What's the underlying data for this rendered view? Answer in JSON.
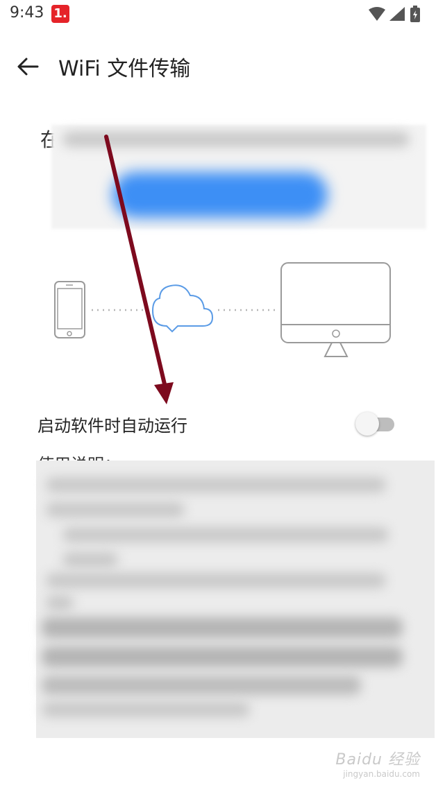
{
  "status_bar": {
    "time": "9:43",
    "badge": "1."
  },
  "appbar": {
    "title": "WiFi 文件传输"
  },
  "intro": {
    "partial_char": "在"
  },
  "settings": {
    "auto_run_label": "启动软件时自动运行",
    "auto_run_enabled": false
  },
  "usage": {
    "heading": "使用说明："
  },
  "watermark": {
    "brand": "Baidu 经验",
    "url": "jingyan.baidu.com"
  },
  "colors": {
    "accent_blue": "#3d8ff5",
    "cloud_blue": "#5a9be6",
    "arrow": "#7d0a1e",
    "badge_red": "#e52329"
  },
  "icons": [
    "back-arrow-icon",
    "wifi-icon",
    "signal-icon",
    "battery-icon",
    "phone-icon",
    "cloud-icon",
    "monitor-icon"
  ]
}
